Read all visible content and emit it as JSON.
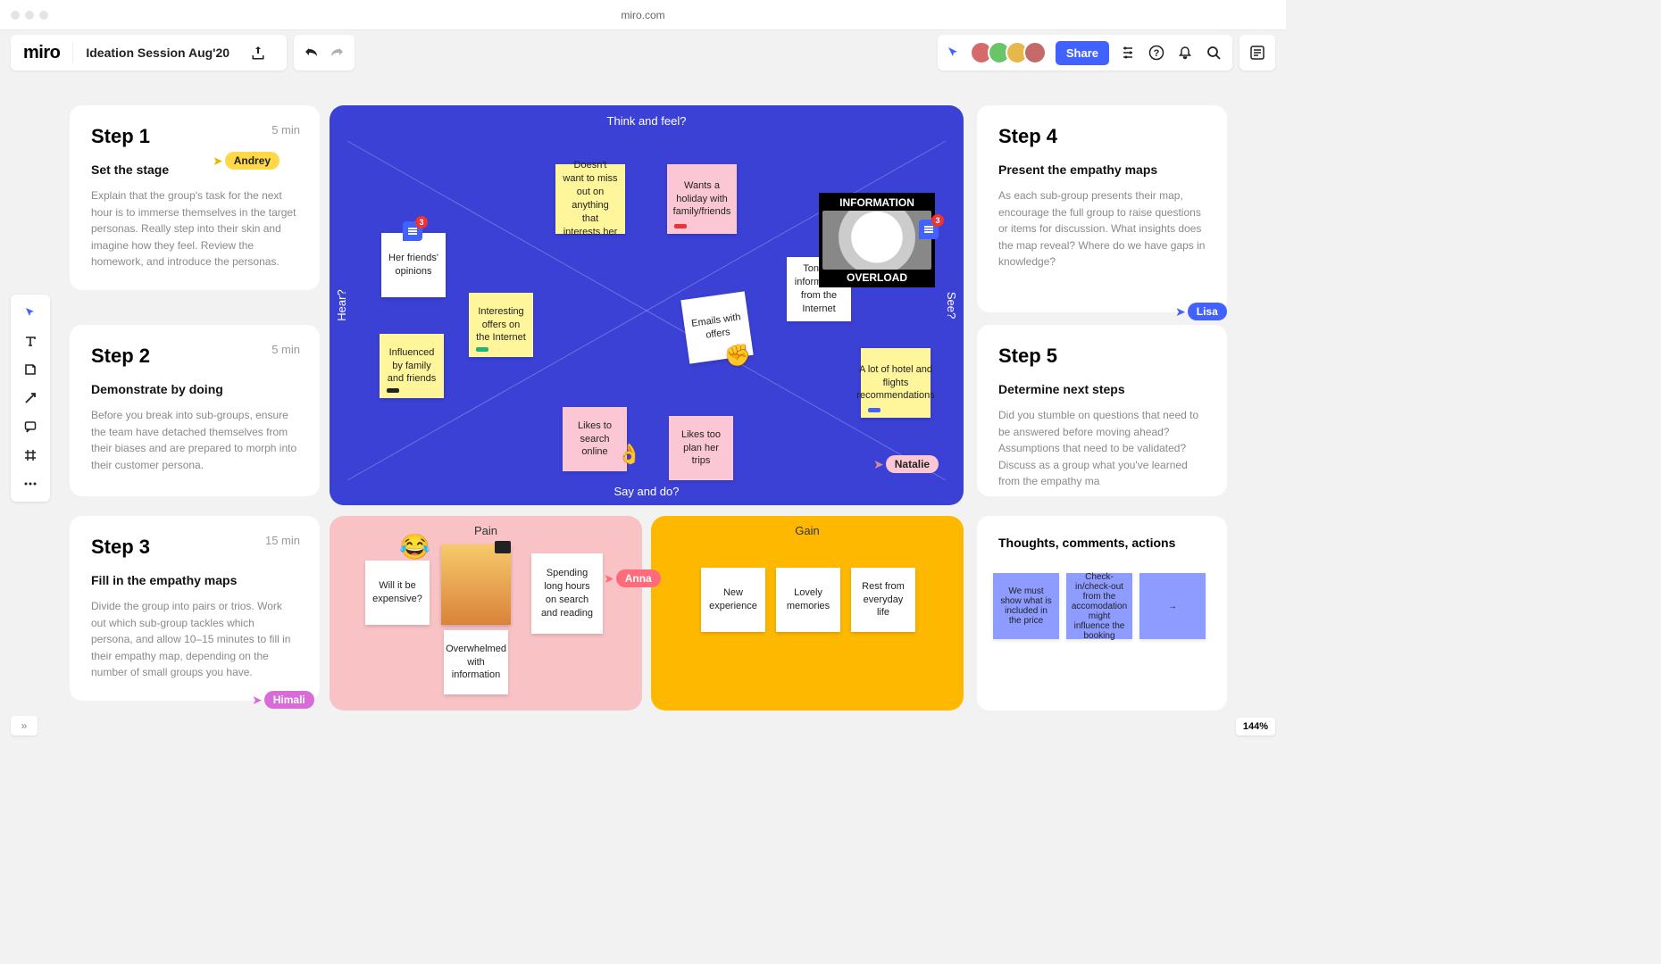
{
  "browser": {
    "url": "miro.com"
  },
  "header": {
    "logo": "miro",
    "board_title": "Ideation Session Aug'20",
    "share_label": "Share",
    "avatar_colors": [
      "#d46a6a",
      "#6ac46a",
      "#e6b84a",
      "#c46a6a"
    ],
    "cursor_icon_color": "#4262ff"
  },
  "steps": [
    {
      "num": "Step 1",
      "time": "5 min",
      "title": "Set the stage",
      "body": "Explain that the group's task for the next hour is to immerse themselves in the target personas. Really step into their skin and imagine how they feel. Review the homework, and introduce the personas."
    },
    {
      "num": "Step 2",
      "time": "5 min",
      "title": "Demonstrate by doing",
      "body": "Before you break into sub-groups, ensure the team have detached themselves from their biases and are prepared to morph into their customer persona."
    },
    {
      "num": "Step 3",
      "time": "15 min",
      "title": "Fill in the empathy maps",
      "body": "Divide the group into pairs or trios. Work out which sub-group tackles which persona, and allow 10–15 minutes to fill in their empathy map, depending on the number of small groups you have."
    },
    {
      "num": "Step 4",
      "time": "",
      "title": "Present the empathy maps",
      "body": "As each sub-group presents their map, encourage the full group to raise questions or items for discussion. What insights does the map reveal? Where do we have gaps in knowledge?"
    },
    {
      "num": "Step 5",
      "time": "",
      "title": "Determine next steps",
      "body": "Did you stumble on questions that need to be answered before moving ahead? Assumptions that need to be validated? Discuss as a group what you've learned from the empathy ma"
    }
  ],
  "thoughts_title": "Thoughts, comments, actions",
  "empathy": {
    "labels": {
      "top": "Think and feel?",
      "left": "Hear?",
      "right": "See?",
      "bottom": "Say and do?"
    },
    "stickies": {
      "friends_opinions": {
        "text": "Her friends' opinions",
        "bg": "#ffffff"
      },
      "influenced": {
        "text": "Influenced by family and friends",
        "bg": "#fff59a",
        "tag": "#222"
      },
      "interesting_offers": {
        "text": "Interesting offers on the Internet",
        "bg": "#fff59a",
        "tag": "#1eb37a"
      },
      "miss_out": {
        "text": "Doesn't want to miss out on anything that interests her",
        "bg": "#fff59a"
      },
      "holiday": {
        "text": "Wants a holiday with family/friends",
        "bg": "#fbc7d4",
        "tag": "#e33"
      },
      "emails": {
        "text": "Emails with offers",
        "bg": "#ffffff"
      },
      "tons_info": {
        "text": "Tons of information from the Internet",
        "bg": "#ffffff"
      },
      "recs": {
        "text": "A lot of hotel and flights recommendations",
        "bg": "#fff59a",
        "tag": "#4262ff"
      },
      "search_online": {
        "text": "Likes to search online",
        "bg": "#fbc7d4"
      },
      "plan_trips": {
        "text": "Likes too plan her trips",
        "bg": "#fbc7d4"
      }
    },
    "meme": {
      "top": "INFORMATION",
      "bottom": "OVERLOAD"
    },
    "comment_badges": {
      "left": "3",
      "right": "3"
    }
  },
  "pain": {
    "title": "Pain",
    "stickies": {
      "expensive": {
        "text": "Will it be expensive?",
        "bg": "#ffffff"
      },
      "overwhelmed": {
        "text": "Overwhelmed with information",
        "bg": "#ffffff"
      },
      "spending": {
        "text": "Spending long hours on search and reading",
        "bg": "#ffffff"
      }
    },
    "emoji": "😂"
  },
  "gain": {
    "title": "Gain",
    "stickies": {
      "new_exp": {
        "text": "New experience",
        "bg": "#ffffff"
      },
      "memories": {
        "text": "Lovely memories",
        "bg": "#ffffff"
      },
      "rest": {
        "text": "Rest from everyday life",
        "bg": "#ffffff"
      }
    }
  },
  "purple_notes": {
    "a": "We must show what is included in the price",
    "b": "Check-in/check-out from the accomodation might influence the booking",
    "c": "→"
  },
  "cursors": {
    "andrey": {
      "name": "Andrey",
      "bg": "#ffd84a"
    },
    "lisa": {
      "name": "Lisa",
      "bg": "#4262ff",
      "fg": "#fff"
    },
    "natalie": {
      "name": "Natalie",
      "bg": "#fbc7d4"
    },
    "anna": {
      "name": "Anna",
      "bg": "#ff6b7a",
      "fg": "#fff"
    },
    "himali": {
      "name": "Himali",
      "bg": "#d96bd9",
      "fg": "#fff"
    }
  },
  "zoom": "144%"
}
